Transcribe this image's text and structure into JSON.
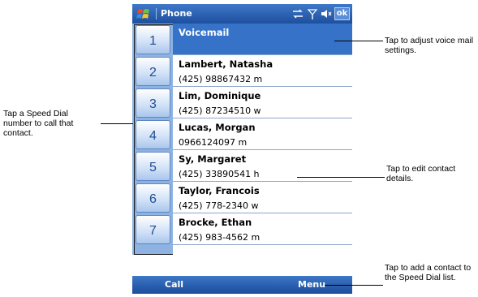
{
  "titlebar": {
    "title": "Phone",
    "ok_label": "ok"
  },
  "speed_dial": [
    "1",
    "2",
    "3",
    "4",
    "5",
    "6",
    "7"
  ],
  "entries": [
    {
      "name": "Voicemail",
      "number": ""
    },
    {
      "name": "Lambert, Natasha",
      "number": "(425) 98867432 m"
    },
    {
      "name": "Lim, Dominique",
      "number": "(425) 87234510 w"
    },
    {
      "name": "Lucas, Morgan",
      "number": "0966124097 m"
    },
    {
      "name": "Sy, Margaret",
      "number": "(425) 33890541 h"
    },
    {
      "name": "Taylor, Francois",
      "number": "(425) 778-2340 w"
    },
    {
      "name": "Brocke, Ethan",
      "number": "(425) 983-4562 m"
    }
  ],
  "softkeys": {
    "left": "Call",
    "right": "Menu"
  },
  "callouts": {
    "voicemail": "Tap to adjust voice mail settings.",
    "speed_dial": "Tap a Speed Dial number to call that contact.",
    "edit": "Tap to edit contact details.",
    "add": "Tap to add a contact to the Speed Dial list."
  },
  "colors": {
    "accent": "#3673c8",
    "dial_panel": "#8eb3e2"
  }
}
